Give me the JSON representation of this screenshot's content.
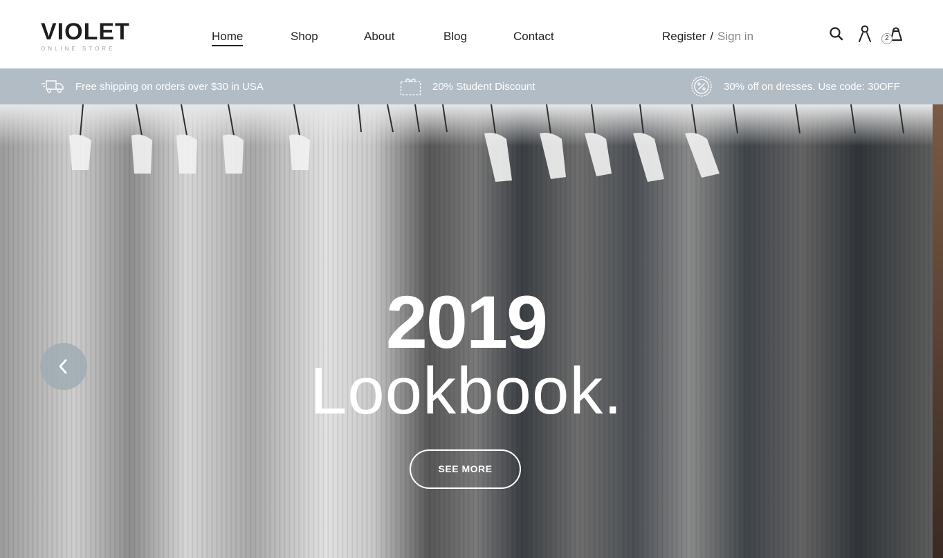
{
  "brand": {
    "name": "VIOLET",
    "tagline": "ONLINE STORE"
  },
  "nav": {
    "items": [
      {
        "label": "Home",
        "active": true
      },
      {
        "label": "Shop",
        "active": false
      },
      {
        "label": "About",
        "active": false
      },
      {
        "label": "Blog",
        "active": false
      },
      {
        "label": "Contact",
        "active": false
      }
    ]
  },
  "auth": {
    "register": "Register",
    "separator": "/",
    "sign_in": "Sign in"
  },
  "header_icons": {
    "search": "search-icon",
    "account": "user-icon",
    "cart": "shopping-bag-icon"
  },
  "cart": {
    "count": "2"
  },
  "promo": {
    "items": [
      {
        "icon": "delivery-truck-icon",
        "text": "Free shipping on orders over $30 in USA"
      },
      {
        "icon": "gift-voucher-icon",
        "text": "20% Student Discount"
      },
      {
        "icon": "percent-badge-icon",
        "text": "30% off on dresses. Use code: 30OFF"
      }
    ]
  },
  "hero": {
    "year": "2019",
    "title": "Lookbook.",
    "button": "SEE MORE",
    "prev_icon": "chevron-left-icon"
  },
  "colors": {
    "promo_bar": "#b2bcc4",
    "prev_button": "#a0acb4",
    "text_dark": "#222222",
    "text_muted": "#888888"
  }
}
